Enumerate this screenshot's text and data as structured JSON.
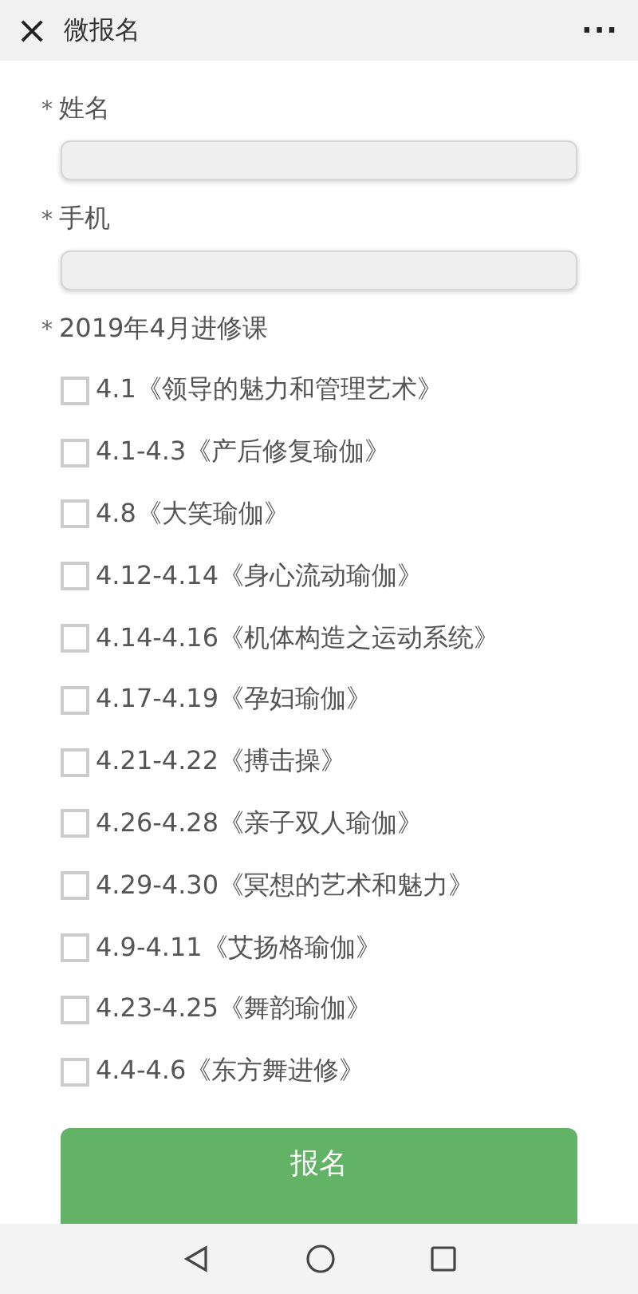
{
  "header": {
    "close": "×",
    "title": "微报名",
    "more": "···"
  },
  "fields": [
    {
      "required": "*",
      "label": "姓名"
    },
    {
      "required": "*",
      "label": "手机"
    }
  ],
  "course_group": {
    "required": "*",
    "label": "2019年4月进修课",
    "options": [
      {
        "label": "4.1《领导的魅力和管理艺术》",
        "checked": false
      },
      {
        "label": "4.1-4.3《产后修复瑜伽》",
        "checked": false
      },
      {
        "label": "4.8《大笑瑜伽》",
        "checked": false
      },
      {
        "label": "4.12-4.14《身心流动瑜伽》",
        "checked": false
      },
      {
        "label": "4.14-4.16《机体构造之运动系统》",
        "checked": false
      },
      {
        "label": "4.17-4.19《孕妇瑜伽》",
        "checked": false
      },
      {
        "label": "4.21-4.22《搏击操》",
        "checked": false
      },
      {
        "label": "4.26-4.28《亲子双人瑜伽》",
        "checked": false
      },
      {
        "label": "4.29-4.30《冥想的艺术和魅力》",
        "checked": false
      },
      {
        "label": "4.9-4.11《艾扬格瑜伽》",
        "checked": false
      },
      {
        "label": "4.23-4.25《舞韵瑜伽》",
        "checked": false
      },
      {
        "label": "4.4-4.6《东方舞进修》",
        "checked": false
      }
    ]
  },
  "submit": "报名"
}
